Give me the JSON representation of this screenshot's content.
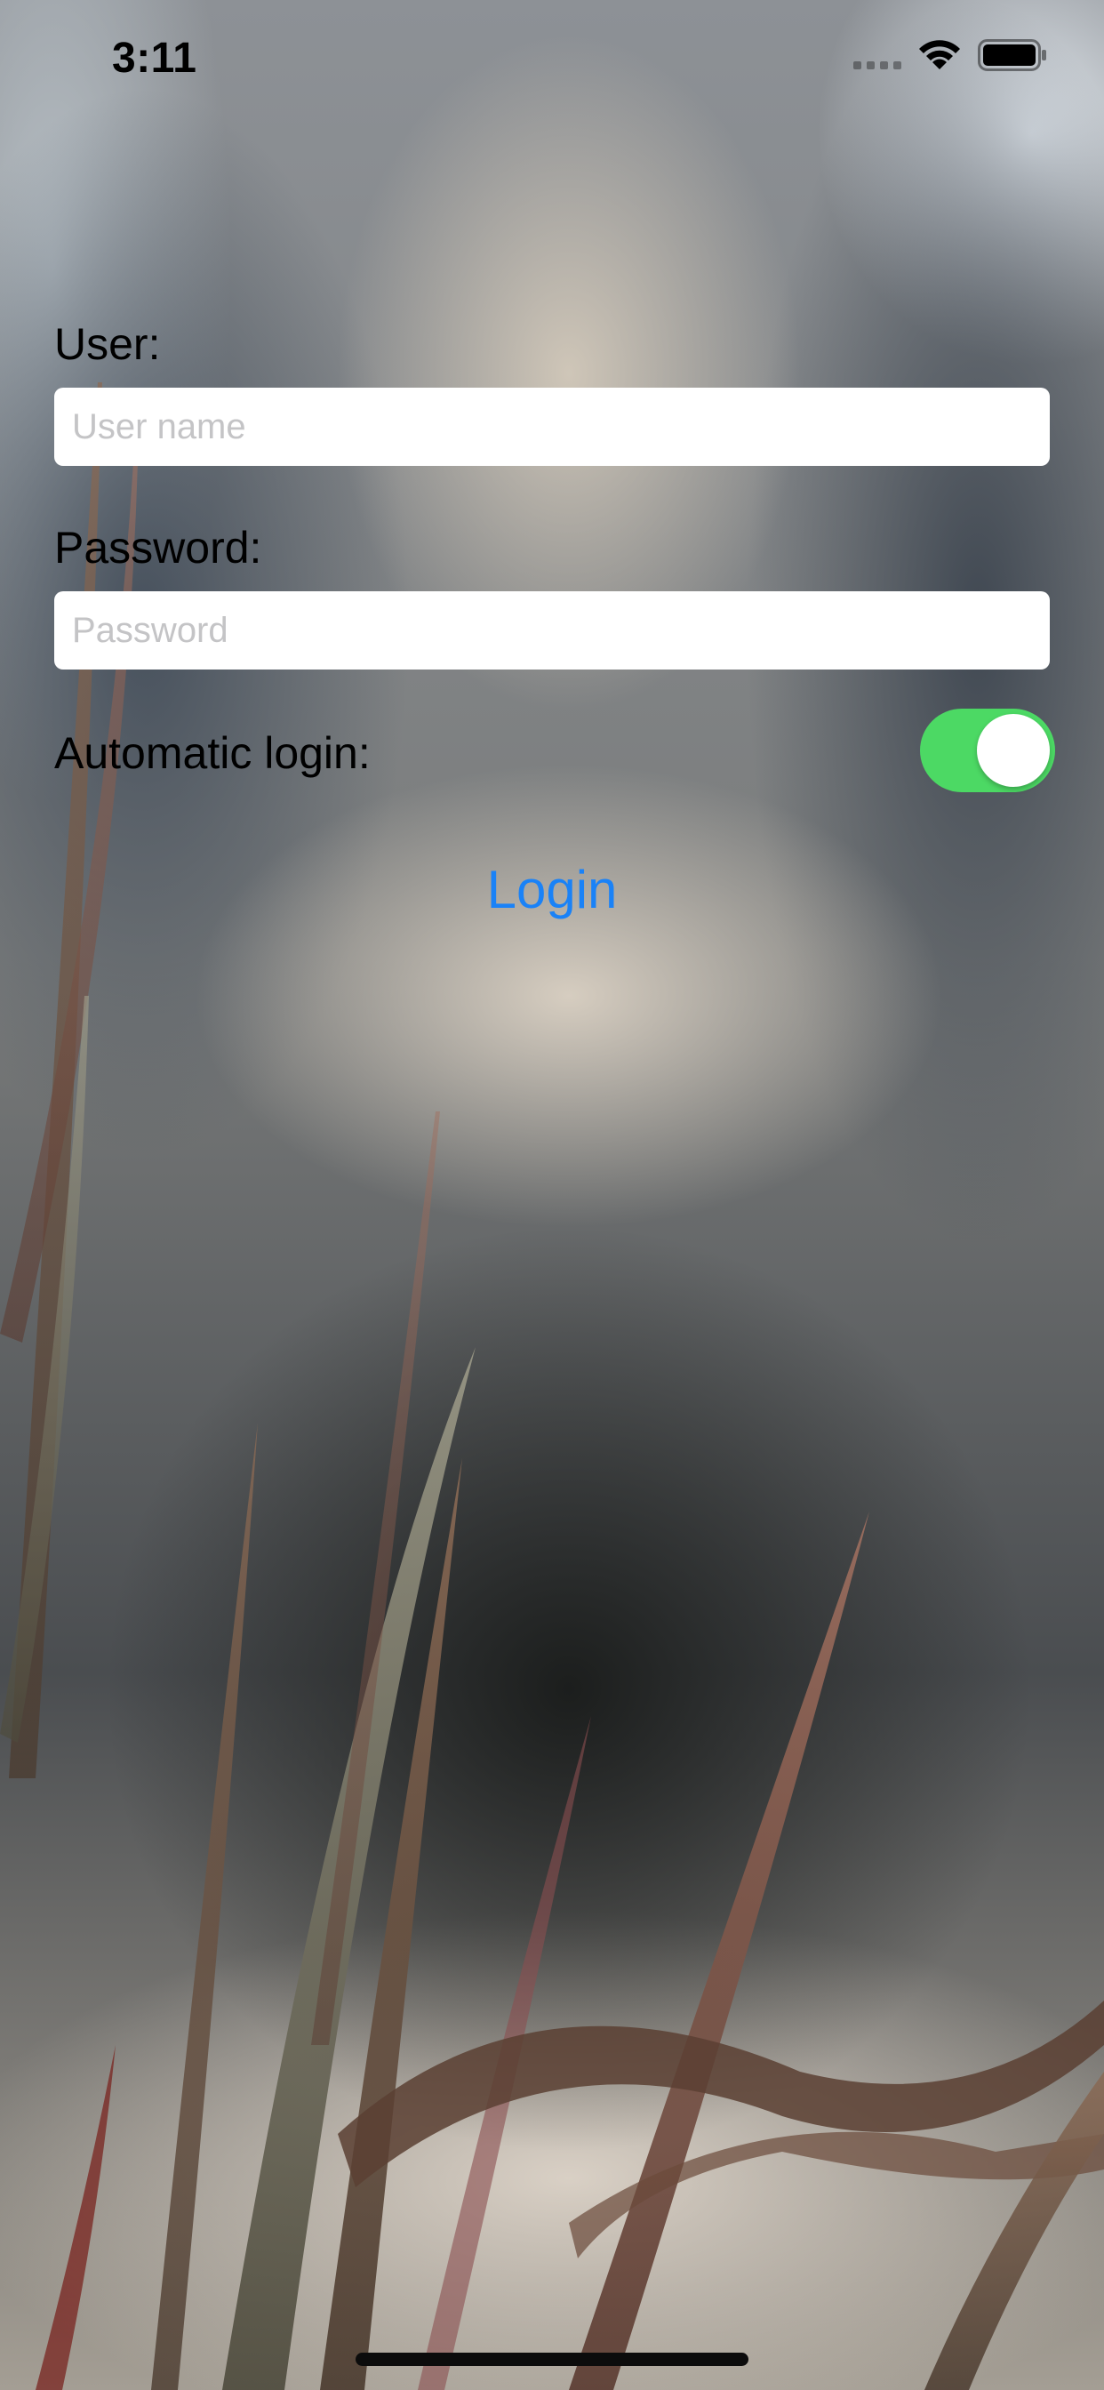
{
  "status_bar": {
    "time": "3:11",
    "icons": [
      "cellular-signal-icon",
      "wifi-icon",
      "battery-icon"
    ]
  },
  "form": {
    "user_label": "User:",
    "user_placeholder": "User name",
    "user_value": "",
    "password_label": "Password:",
    "password_placeholder": "Password",
    "password_value": "",
    "auto_login_label": "Automatic login:",
    "auto_login_enabled": true,
    "login_button_label": "Login"
  },
  "colors": {
    "accent": "#1a82f7",
    "toggle_on": "#4cd964",
    "field_background": "#ffffff",
    "placeholder": "#c4c4c6"
  }
}
